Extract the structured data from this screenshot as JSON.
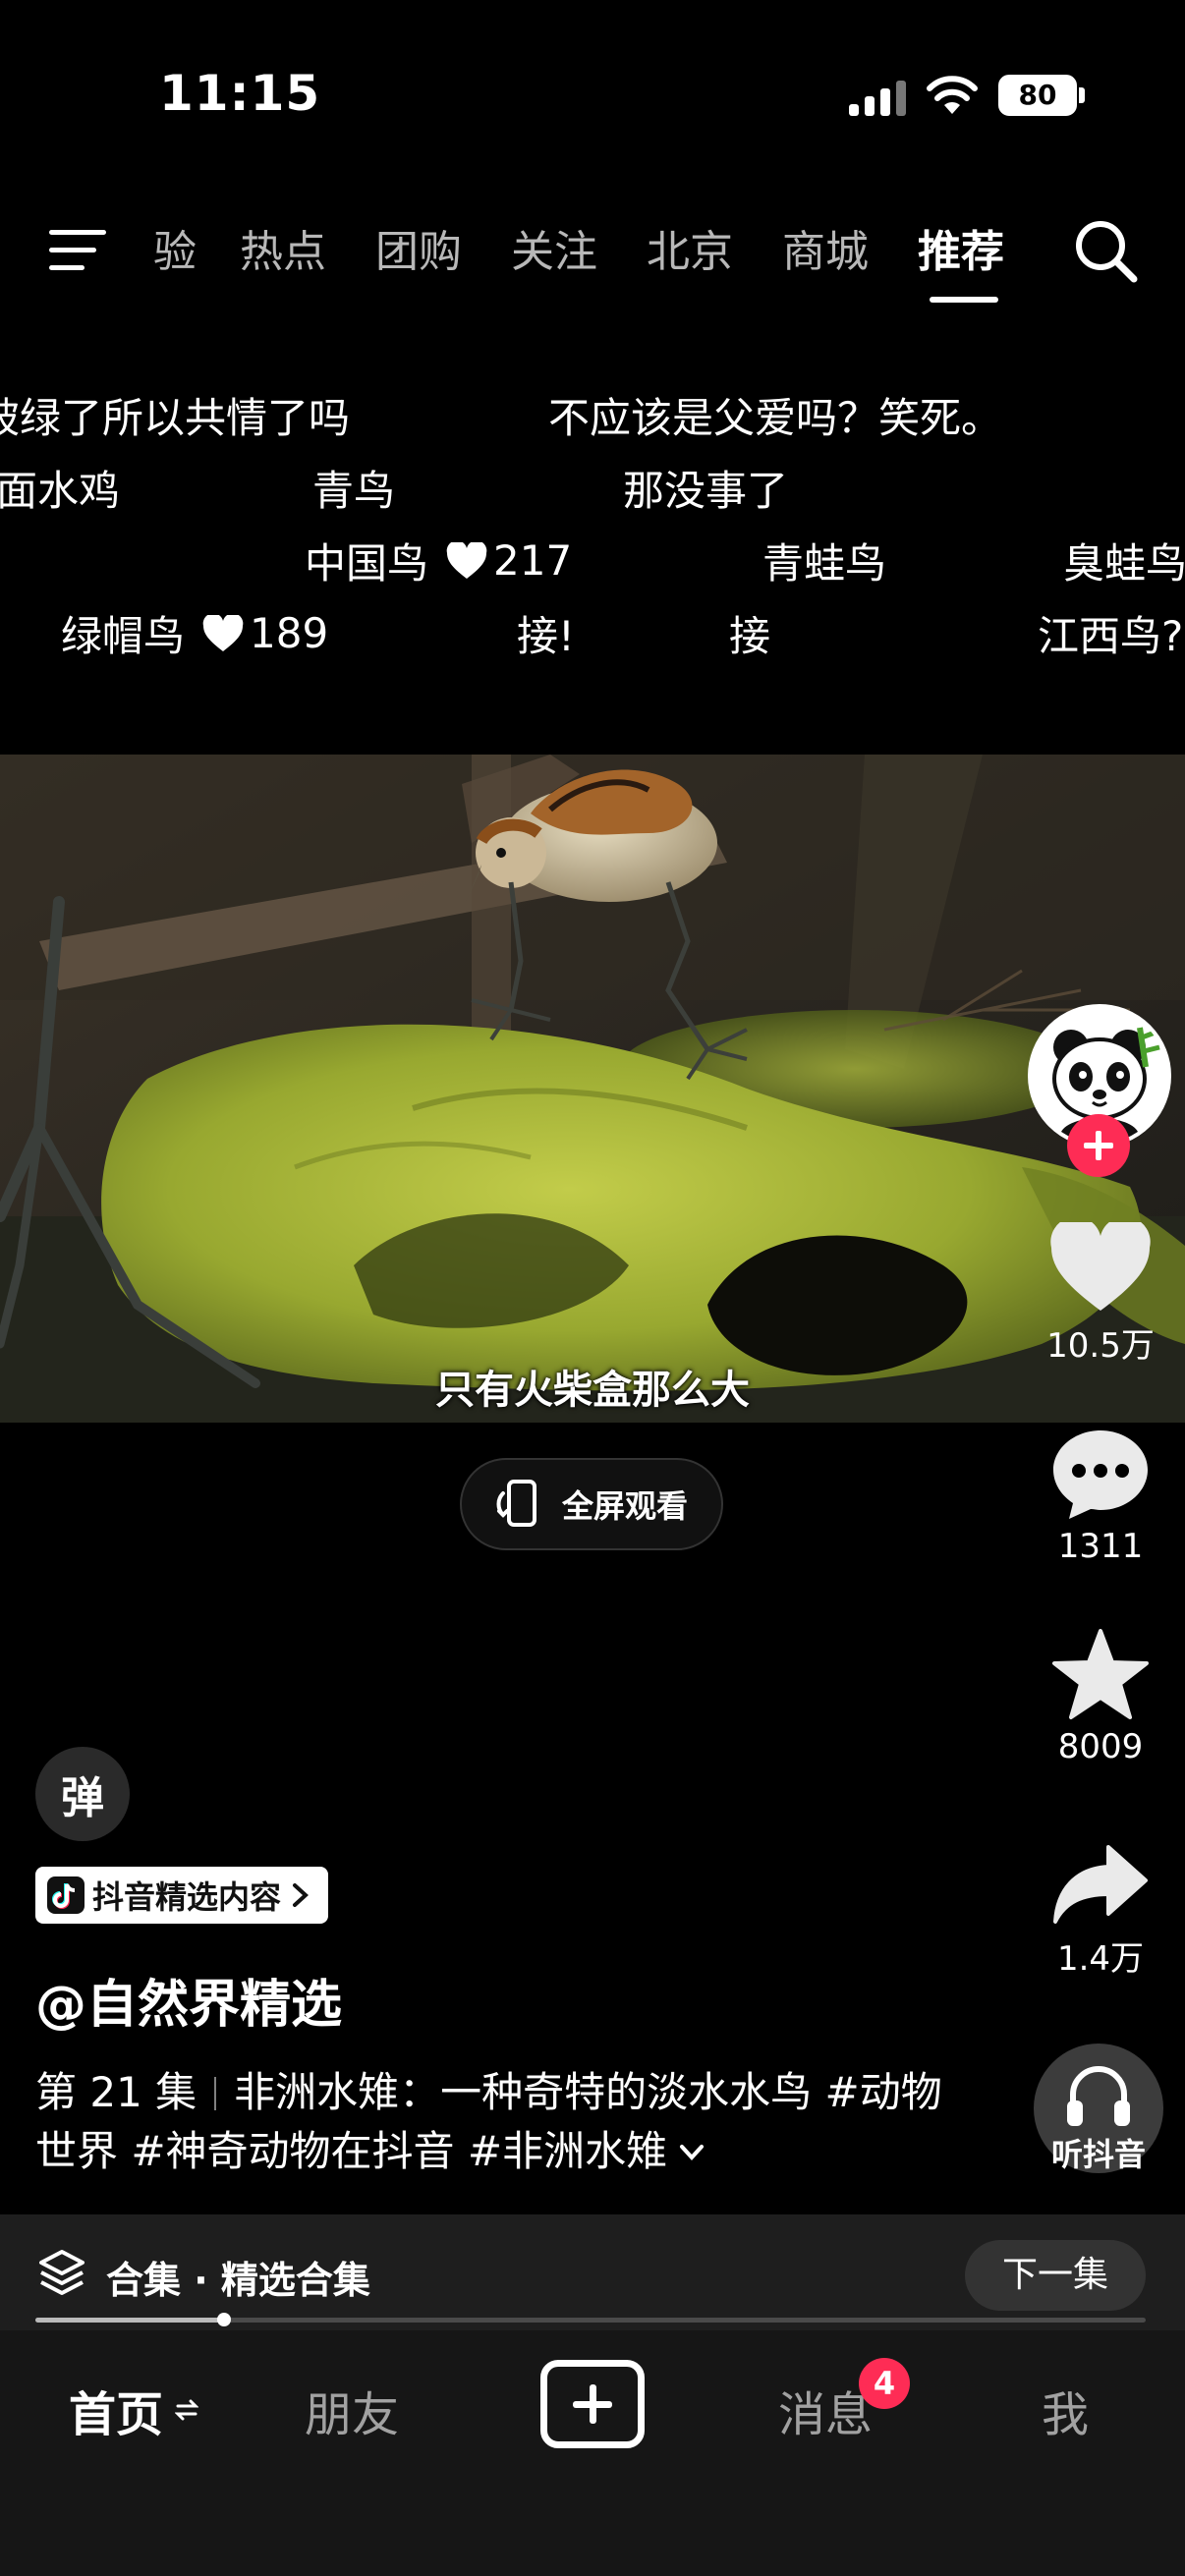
{
  "status_bar": {
    "time": "11:15",
    "battery": "80",
    "icons": [
      "signal-icon",
      "wifi-icon",
      "battery-icon"
    ]
  },
  "top_nav": {
    "tabs": [
      {
        "label": "验",
        "active": false
      },
      {
        "label": "热点",
        "active": false
      },
      {
        "label": "团购",
        "active": false
      },
      {
        "label": "关注",
        "active": false
      },
      {
        "label": "北京",
        "active": false
      },
      {
        "label": "商城",
        "active": false
      },
      {
        "label": "推荐",
        "active": true
      }
    ],
    "icons": [
      "menu-icon",
      "search-icon"
    ]
  },
  "danmaku": [
    {
      "text": "被绿了所以共情了吗"
    },
    {
      "text": "不应该是父爱吗？笑死。"
    },
    {
      "text": "面水鸡"
    },
    {
      "text": "青鸟"
    },
    {
      "text": "那没事了"
    },
    {
      "text": "中国鸟",
      "likes": "217"
    },
    {
      "text": "青蛙鸟"
    },
    {
      "text": "臭蛙鸟"
    },
    {
      "text": "绿帽鸟",
      "likes": "189"
    },
    {
      "text": "接!"
    },
    {
      "text": "接"
    },
    {
      "text": "江西鸟?"
    }
  ],
  "video": {
    "subtitle": "只有火柴盒那么大",
    "fullscreen_label": "全屏观看"
  },
  "actions": {
    "likes": "10.5万",
    "comments": "1311",
    "favorites": "8009",
    "shares": "1.4万",
    "listen_label": "听抖音"
  },
  "info": {
    "danmu_toggle": "弹",
    "source_badge": "抖音精选内容",
    "author": "@自然界精选",
    "episode": "第 21 集",
    "description": "非洲水雉：一种奇特的淡水水鸟 #动物世界 #神奇动物在抖音 #非洲水雉"
  },
  "collection": {
    "label": "合集 · 精选合集",
    "next_label": "下一集",
    "progress": 0.17
  },
  "tab_bar": {
    "tabs": [
      {
        "label": "首页",
        "active": true
      },
      {
        "label": "朋友",
        "active": false
      },
      {
        "label": "消息",
        "active": false,
        "badge": "4"
      },
      {
        "label": "我",
        "active": false
      }
    ]
  },
  "colors": {
    "accent": "#fe2c55",
    "background": "#000000",
    "bar_background": "#161616"
  }
}
